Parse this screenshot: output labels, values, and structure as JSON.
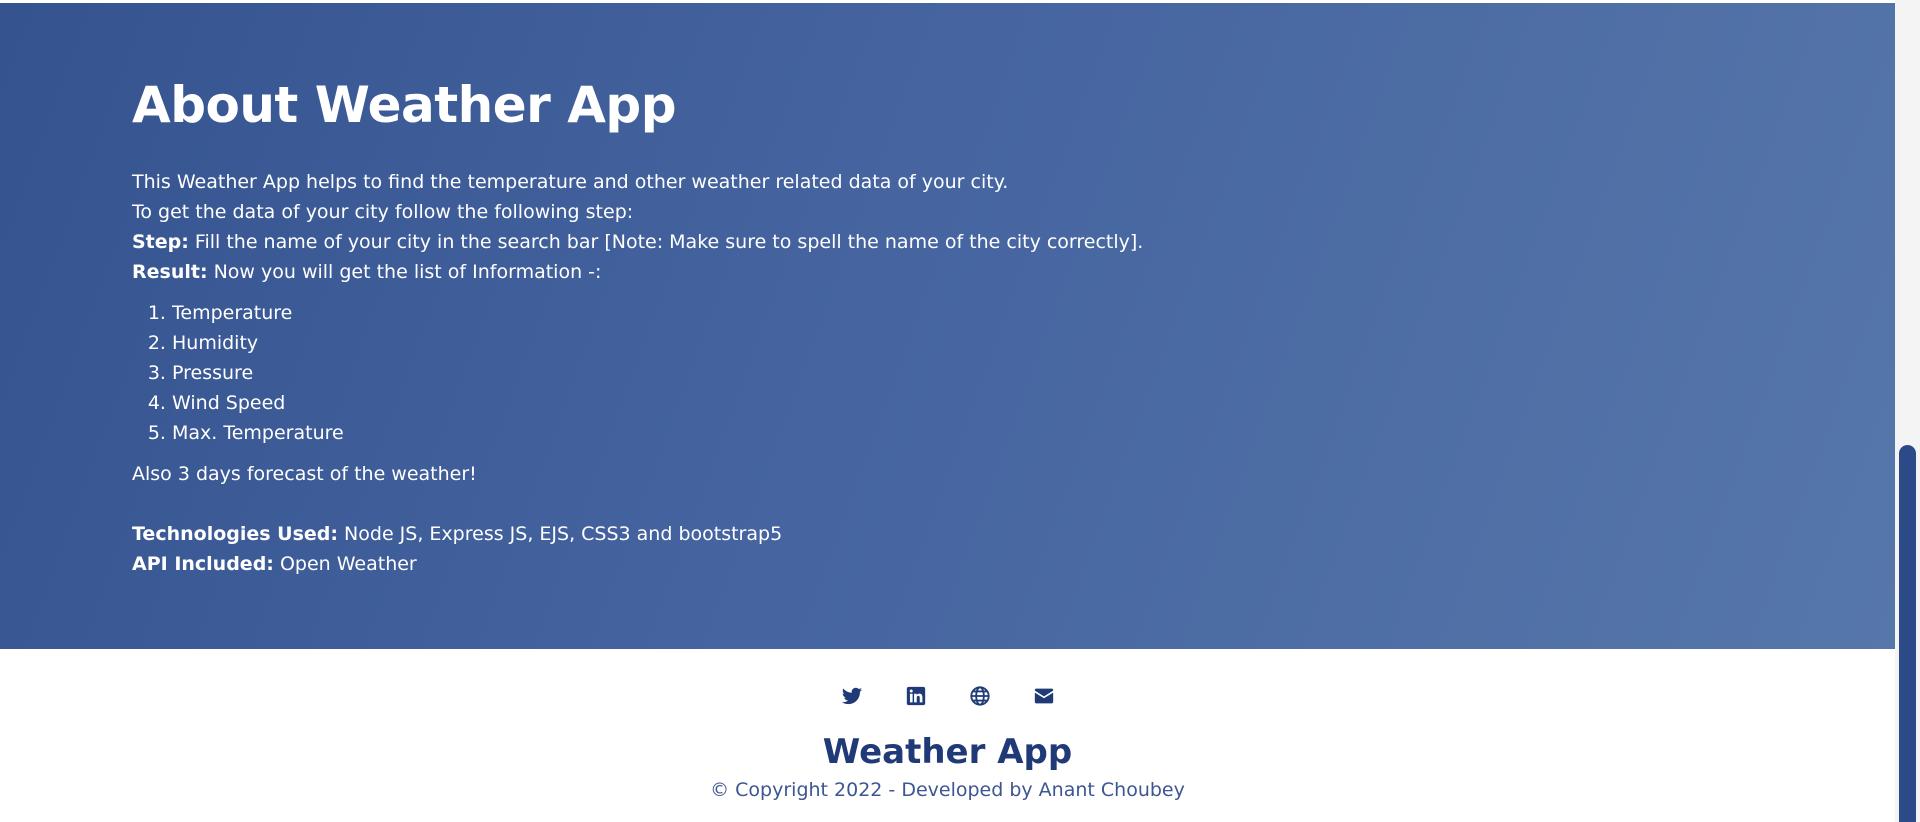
{
  "about": {
    "title": "About Weather App",
    "intro_line1": "This Weather App helps to find the temperature and other weather related data of your city.",
    "intro_line2": "To get the data of your city follow the following step:",
    "step_label": "Step:",
    "step_text": " Fill the name of your city in the search bar [Note: Make sure to spell the name of the city correctly].",
    "result_label": "Result:",
    "result_text": " Now you will get the list of Information -:",
    "info_list": [
      "Temperature",
      "Humidity",
      "Pressure",
      "Wind Speed",
      "Max. Temperature"
    ],
    "forecast": "Also 3 days forecast of the weather!",
    "tech_label": "Technologies Used:",
    "tech_text": " Node JS, Express JS, EJS, CSS3 and bootstrap5",
    "api_label": "API Included:",
    "api_text": " Open Weather"
  },
  "footer": {
    "social_icons": [
      "twitter-icon",
      "linkedin-icon",
      "globe-icon",
      "envelope-icon"
    ],
    "brand": "Weather App",
    "copyright": "© Copyright 2022 - Developed by Anant Choubey",
    "icon_color": "#1f3a77"
  },
  "colors": {
    "about_gradient_start": "#34538f",
    "about_gradient_end": "#5677aa",
    "brand": "#1f3a77",
    "scrollbar_thumb": "#2b4a87"
  }
}
